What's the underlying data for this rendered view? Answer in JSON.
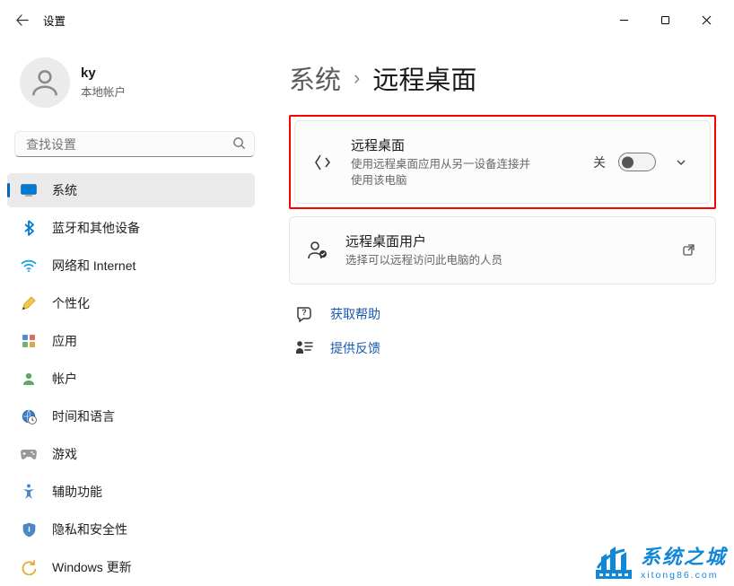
{
  "window": {
    "title": "设置"
  },
  "user": {
    "name": "ky",
    "sub": "本地帐户"
  },
  "search": {
    "placeholder": "查找设置"
  },
  "sidebar": {
    "items": [
      {
        "label": "系统",
        "key": "system",
        "active": true
      },
      {
        "label": "蓝牙和其他设备",
        "key": "bluetooth"
      },
      {
        "label": "网络和 Internet",
        "key": "network"
      },
      {
        "label": "个性化",
        "key": "personalization"
      },
      {
        "label": "应用",
        "key": "apps"
      },
      {
        "label": "帐户",
        "key": "accounts"
      },
      {
        "label": "时间和语言",
        "key": "time"
      },
      {
        "label": "游戏",
        "key": "gaming"
      },
      {
        "label": "辅助功能",
        "key": "accessibility"
      },
      {
        "label": "隐私和安全性",
        "key": "privacy"
      },
      {
        "label": "Windows 更新",
        "key": "update"
      }
    ]
  },
  "breadcrumb": {
    "parent": "系统",
    "current": "远程桌面"
  },
  "cards": {
    "remote": {
      "title": "远程桌面",
      "sub": "使用远程桌面应用从另一设备连接并使用该电脑",
      "toggle_label": "关"
    },
    "users": {
      "title": "远程桌面用户",
      "sub": "选择可以远程访问此电脑的人员"
    }
  },
  "links": {
    "help": "获取帮助",
    "feedback": "提供反馈"
  },
  "watermark": {
    "title": "系统之城",
    "url": "xitong86.com"
  }
}
